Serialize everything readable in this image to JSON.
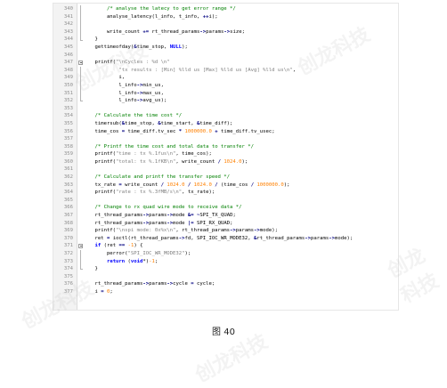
{
  "editor": {
    "lines": [
      {
        "n": "340",
        "marker": "fv",
        "segs": [
          {
            "t": "        "
          },
          {
            "t": "/* analyse the latecy to get error range */",
            "c": "cmt"
          }
        ]
      },
      {
        "n": "341",
        "marker": "fv",
        "segs": [
          {
            "t": "        analyse_latency(l_info, t_info, "
          },
          {
            "t": "++",
            "c": "op"
          },
          {
            "t": "i);"
          }
        ]
      },
      {
        "n": "342",
        "marker": "fv",
        "segs": [
          {
            "t": ""
          }
        ]
      },
      {
        "n": "343",
        "marker": "fv",
        "segs": [
          {
            "t": "        write_count "
          },
          {
            "t": "+=",
            "c": "op"
          },
          {
            "t": " rt_thread_params"
          },
          {
            "t": "->",
            "c": "op"
          },
          {
            "t": "params"
          },
          {
            "t": "->",
            "c": "op"
          },
          {
            "t": "size;"
          }
        ]
      },
      {
        "n": "344",
        "marker": "fe",
        "segs": [
          {
            "t": "    }"
          }
        ]
      },
      {
        "n": "345",
        "marker": "",
        "segs": [
          {
            "t": "    gettimeofday("
          },
          {
            "t": "&",
            "c": "op"
          },
          {
            "t": "time_stop, "
          },
          {
            "t": "NULL",
            "c": "kw"
          },
          {
            "t": ");"
          }
        ]
      },
      {
        "n": "346",
        "marker": "",
        "segs": [
          {
            "t": ""
          }
        ]
      },
      {
        "n": "347",
        "marker": "fm",
        "segs": [
          {
            "t": "    printf("
          },
          {
            "t": "\"\\nCycles : %d \\n\"",
            "c": "str"
          }
        ]
      },
      {
        "n": "348",
        "marker": "fv",
        "segs": [
          {
            "t": "            "
          },
          {
            "t": "\"tx results : [Min] %lld us [Max] %lld us [Avg] %lld us\\n\"",
            "c": "str"
          },
          {
            "t": ","
          }
        ]
      },
      {
        "n": "349",
        "marker": "fv",
        "segs": [
          {
            "t": "            i,"
          }
        ]
      },
      {
        "n": "350",
        "marker": "fv",
        "segs": [
          {
            "t": "            l_info"
          },
          {
            "t": "->",
            "c": "op"
          },
          {
            "t": "min_us,"
          }
        ]
      },
      {
        "n": "351",
        "marker": "fv",
        "segs": [
          {
            "t": "            l_info"
          },
          {
            "t": "->",
            "c": "op"
          },
          {
            "t": "max_us,"
          }
        ]
      },
      {
        "n": "352",
        "marker": "fe",
        "segs": [
          {
            "t": "            l_info"
          },
          {
            "t": "->",
            "c": "op"
          },
          {
            "t": "avg_us);"
          }
        ]
      },
      {
        "n": "353",
        "marker": "",
        "segs": [
          {
            "t": ""
          }
        ]
      },
      {
        "n": "354",
        "marker": "",
        "segs": [
          {
            "t": "    "
          },
          {
            "t": "/* Calculate the time cost */",
            "c": "cmt"
          }
        ]
      },
      {
        "n": "355",
        "marker": "",
        "segs": [
          {
            "t": "    timersub("
          },
          {
            "t": "&",
            "c": "op"
          },
          {
            "t": "time_stop, "
          },
          {
            "t": "&",
            "c": "op"
          },
          {
            "t": "time_start, "
          },
          {
            "t": "&",
            "c": "op"
          },
          {
            "t": "time_diff);"
          }
        ]
      },
      {
        "n": "356",
        "marker": "",
        "segs": [
          {
            "t": "    time_cos "
          },
          {
            "t": "=",
            "c": "op"
          },
          {
            "t": " time_diff.tv_sec "
          },
          {
            "t": "*",
            "c": "op"
          },
          {
            "t": " "
          },
          {
            "t": "1000000.0",
            "c": "num"
          },
          {
            "t": " "
          },
          {
            "t": "+",
            "c": "op"
          },
          {
            "t": " time_diff.tv_usec;"
          }
        ]
      },
      {
        "n": "357",
        "marker": "",
        "segs": [
          {
            "t": ""
          }
        ]
      },
      {
        "n": "358",
        "marker": "",
        "segs": [
          {
            "t": "    "
          },
          {
            "t": "/* Printf the time cost and total data to transfer */",
            "c": "cmt"
          }
        ]
      },
      {
        "n": "359",
        "marker": "",
        "segs": [
          {
            "t": "    printf("
          },
          {
            "t": "\"time : tx %.1fus\\n\"",
            "c": "str"
          },
          {
            "t": ", time_cos);"
          }
        ]
      },
      {
        "n": "360",
        "marker": "",
        "segs": [
          {
            "t": "    printf("
          },
          {
            "t": "\"total: tx %.1fKB\\n\"",
            "c": "str"
          },
          {
            "t": ", write_count "
          },
          {
            "t": "/",
            "c": "op"
          },
          {
            "t": " "
          },
          {
            "t": "1024.0",
            "c": "num"
          },
          {
            "t": ");"
          }
        ]
      },
      {
        "n": "361",
        "marker": "",
        "segs": [
          {
            "t": ""
          }
        ]
      },
      {
        "n": "362",
        "marker": "",
        "segs": [
          {
            "t": "    "
          },
          {
            "t": "/* Calculate and printf the transfer speed */",
            "c": "cmt"
          }
        ]
      },
      {
        "n": "363",
        "marker": "",
        "segs": [
          {
            "t": "    tx_rate "
          },
          {
            "t": "=",
            "c": "op"
          },
          {
            "t": " write_count "
          },
          {
            "t": "/",
            "c": "op"
          },
          {
            "t": " "
          },
          {
            "t": "1024.0",
            "c": "num"
          },
          {
            "t": " "
          },
          {
            "t": "/",
            "c": "op"
          },
          {
            "t": " "
          },
          {
            "t": "1024.0",
            "c": "num"
          },
          {
            "t": " "
          },
          {
            "t": "/",
            "c": "op"
          },
          {
            "t": " (time_cos "
          },
          {
            "t": "/",
            "c": "op"
          },
          {
            "t": " "
          },
          {
            "t": "1000000.0",
            "c": "num"
          },
          {
            "t": ");"
          }
        ]
      },
      {
        "n": "364",
        "marker": "",
        "segs": [
          {
            "t": "    printf("
          },
          {
            "t": "\"rate : tx %.3fMB/s\\n\"",
            "c": "str"
          },
          {
            "t": ", tx_rate);"
          }
        ]
      },
      {
        "n": "365",
        "marker": "",
        "segs": [
          {
            "t": ""
          }
        ]
      },
      {
        "n": "366",
        "marker": "",
        "segs": [
          {
            "t": "    "
          },
          {
            "t": "/* Change to rx quad wire mode to receive data */",
            "c": "cmt"
          }
        ]
      },
      {
        "n": "367",
        "marker": "",
        "segs": [
          {
            "t": "    rt_thread_params"
          },
          {
            "t": "->",
            "c": "op"
          },
          {
            "t": "params"
          },
          {
            "t": "->",
            "c": "op"
          },
          {
            "t": "mode "
          },
          {
            "t": "&=",
            "c": "op"
          },
          {
            "t": " "
          },
          {
            "t": "~",
            "c": "op"
          },
          {
            "t": "SPI_TX_QUAD;"
          }
        ]
      },
      {
        "n": "368",
        "marker": "",
        "segs": [
          {
            "t": "    rt_thread_params"
          },
          {
            "t": "->",
            "c": "op"
          },
          {
            "t": "params"
          },
          {
            "t": "->",
            "c": "op"
          },
          {
            "t": "mode "
          },
          {
            "t": "|=",
            "c": "op"
          },
          {
            "t": " SPI_RX_QUAD;"
          }
        ]
      },
      {
        "n": "369",
        "marker": "",
        "segs": [
          {
            "t": "    printf("
          },
          {
            "t": "\"\\nspi mode: 0x%x\\n\"",
            "c": "str"
          },
          {
            "t": ", rt_thread_params"
          },
          {
            "t": "->",
            "c": "op"
          },
          {
            "t": "params"
          },
          {
            "t": "->",
            "c": "op"
          },
          {
            "t": "mode);"
          }
        ]
      },
      {
        "n": "370",
        "marker": "",
        "segs": [
          {
            "t": "    ret "
          },
          {
            "t": "=",
            "c": "op"
          },
          {
            "t": " ioctl(rt_thread_params"
          },
          {
            "t": "->",
            "c": "op"
          },
          {
            "t": "fd, SPI_IOC_WR_MODE32, "
          },
          {
            "t": "&",
            "c": "op"
          },
          {
            "t": "rt_thread_params"
          },
          {
            "t": "->",
            "c": "op"
          },
          {
            "t": "params"
          },
          {
            "t": "->",
            "c": "op"
          },
          {
            "t": "mode);"
          }
        ]
      },
      {
        "n": "371",
        "marker": "fm",
        "segs": [
          {
            "t": "    "
          },
          {
            "t": "if",
            "c": "kw"
          },
          {
            "t": " (ret "
          },
          {
            "t": "==",
            "c": "op"
          },
          {
            "t": " "
          },
          {
            "t": "-1",
            "c": "num"
          },
          {
            "t": ") {"
          }
        ]
      },
      {
        "n": "372",
        "marker": "fv",
        "segs": [
          {
            "t": "        perror("
          },
          {
            "t": "\"SPI_IOC_WR_MODE32\"",
            "c": "str"
          },
          {
            "t": ");"
          }
        ]
      },
      {
        "n": "373",
        "marker": "fv",
        "segs": [
          {
            "t": "        "
          },
          {
            "t": "return",
            "c": "kw"
          },
          {
            "t": " ("
          },
          {
            "t": "void",
            "c": "kw"
          },
          {
            "t": "*)"
          },
          {
            "t": "-1",
            "c": "num"
          },
          {
            "t": ";"
          }
        ]
      },
      {
        "n": "374",
        "marker": "fe",
        "segs": [
          {
            "t": "    }"
          }
        ]
      },
      {
        "n": "375",
        "marker": "",
        "segs": [
          {
            "t": ""
          }
        ]
      },
      {
        "n": "376",
        "marker": "",
        "segs": [
          {
            "t": "    rt_thread_params"
          },
          {
            "t": "->",
            "c": "op"
          },
          {
            "t": "params"
          },
          {
            "t": "->",
            "c": "op"
          },
          {
            "t": "cycle "
          },
          {
            "t": "=",
            "c": "op"
          },
          {
            "t": " cycle;"
          }
        ]
      },
      {
        "n": "377",
        "marker": "",
        "segs": [
          {
            "t": "    i "
          },
          {
            "t": "=",
            "c": "op"
          },
          {
            "t": " "
          },
          {
            "t": "0",
            "c": "num"
          },
          {
            "t": ";"
          }
        ]
      }
    ]
  },
  "caption": "图 40",
  "watermark": "创龙科技",
  "colors": {
    "comment": "#008000",
    "keyword": "#0000ff",
    "string": "#808080",
    "number": "#ff8000",
    "operator": "#000080",
    "gutter_bg": "#f3f3f3",
    "line_number": "#8f8f8f"
  }
}
